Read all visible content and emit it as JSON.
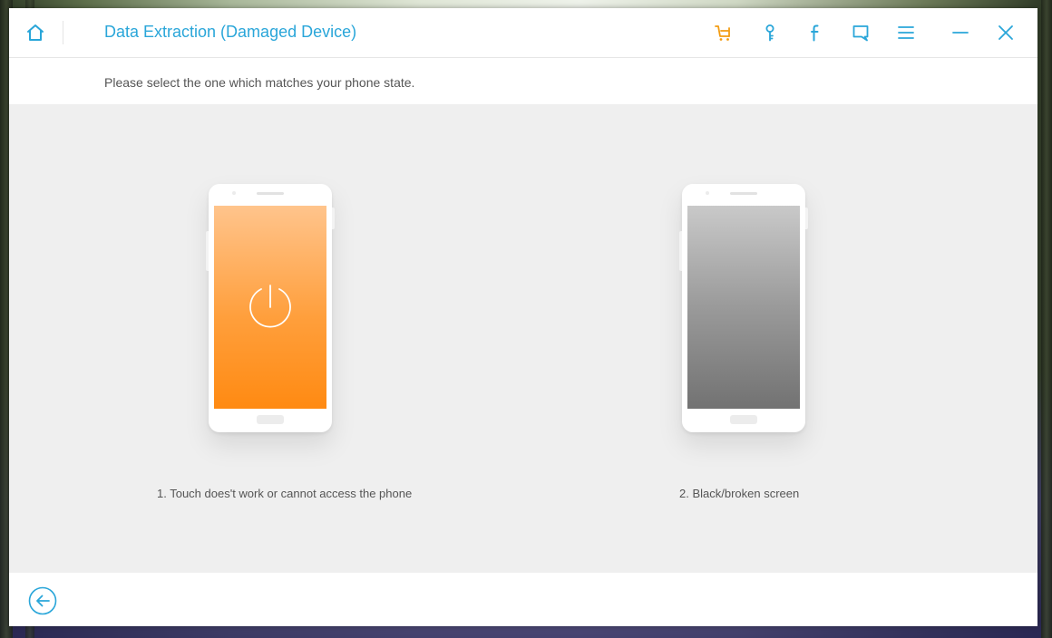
{
  "window": {
    "title": "Data Extraction (Damaged Device)"
  },
  "toolbar": {
    "icons": [
      "home-icon",
      "cart-icon",
      "key-icon",
      "facebook-icon",
      "feedback-icon",
      "menu-icon",
      "minimize-icon",
      "close-icon"
    ]
  },
  "main": {
    "instruction": "Please select the one which matches your phone state.",
    "options": [
      {
        "label": "1. Touch does't work or cannot access the phone",
        "screen": "orange",
        "icon": "power-icon"
      },
      {
        "label": "2. Black/broken screen",
        "screen": "gray"
      }
    ]
  },
  "footer": {
    "back_icon": "back-arrow-icon"
  },
  "colors": {
    "accent": "#2aa6d9",
    "cart": "#f39c12",
    "orange_screen_top": "#ffc48c",
    "orange_screen_bottom": "#ff8a12",
    "gray_screen_top": "#c9c9c9",
    "gray_screen_bottom": "#727272",
    "content_bg": "#efefef"
  }
}
